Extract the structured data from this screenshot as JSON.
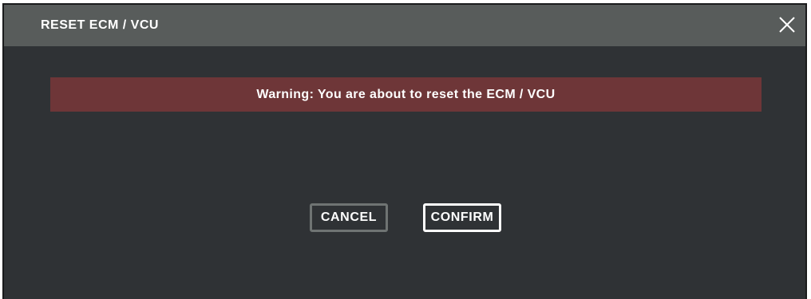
{
  "dialog": {
    "title": "RESET ECM / VCU",
    "close_icon": "close-icon",
    "warning_text": "Warning: You are about to reset the ECM / VCU",
    "buttons": {
      "cancel_label": "CANCEL",
      "confirm_label": "CONFIRM"
    }
  },
  "colors": {
    "titlebar": "#585c5b",
    "body": "#2f3235",
    "warning_banner": "#6e3638",
    "cancel_border": "#6f7473",
    "confirm_border": "#ffffff"
  }
}
